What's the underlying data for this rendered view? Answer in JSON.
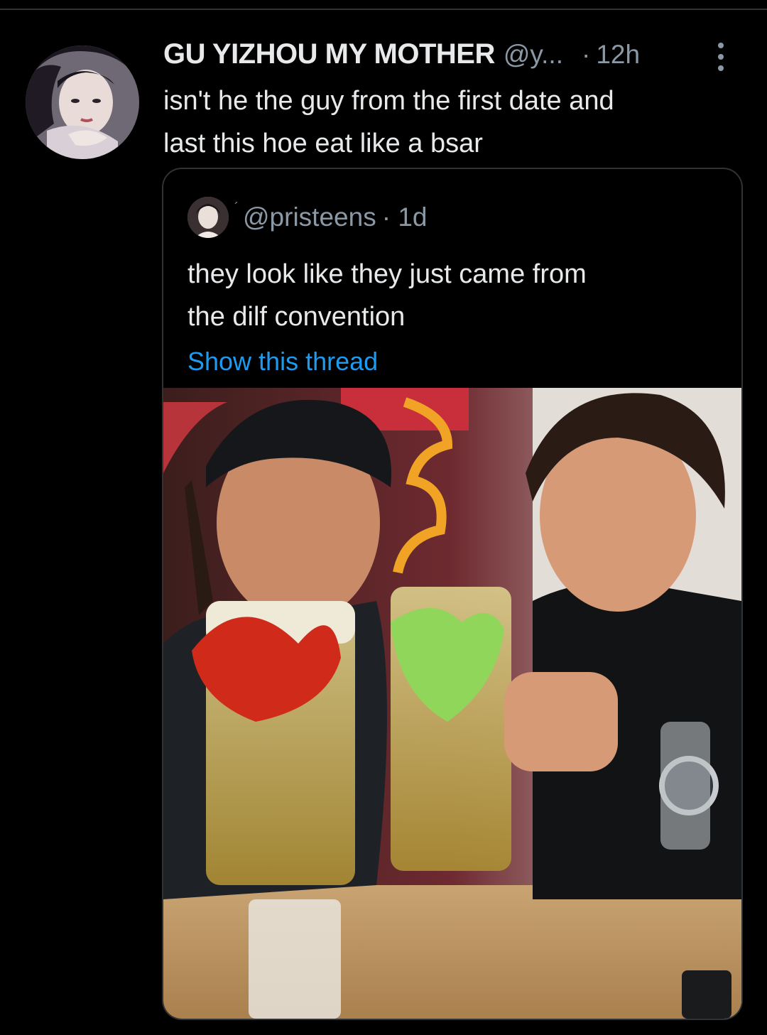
{
  "tweet": {
    "display_name": "GU YIZHOU MY MOTHER",
    "handle": "@y...",
    "separator": "·",
    "time": "12h",
    "text_line1": "isn't he the guy from the first date and",
    "text_line2": "last this hoe eat like a bsar"
  },
  "quoted_tweet": {
    "badge": "´",
    "handle": "@pristeens",
    "separator": "·",
    "time": "1d",
    "text_line1": "they look like they just came from",
    "text_line2": "the dilf convention",
    "show_thread_label": "Show this thread"
  },
  "icons": {
    "more": "more-vertical-icon"
  },
  "colors": {
    "background": "#000000",
    "primary_text": "#e7e9ea",
    "secondary_text": "#8b98a5",
    "link": "#1d9bf0",
    "border": "#2f3336"
  }
}
